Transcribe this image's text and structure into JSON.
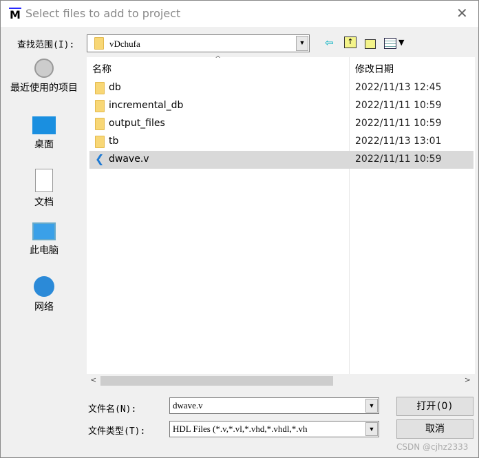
{
  "window": {
    "title": "Select files to add to project",
    "logo": "M"
  },
  "lookin": {
    "label": "查找范围(I):",
    "value": "vDchufa"
  },
  "toolbar": {
    "back": "back-icon",
    "up": "up-folder-icon",
    "new": "new-folder-icon",
    "view": "view-menu-icon"
  },
  "places": [
    {
      "label": "最近使用的项目"
    },
    {
      "label": "桌面"
    },
    {
      "label": "文档"
    },
    {
      "label": "此电脑"
    },
    {
      "label": "网络"
    }
  ],
  "columns": {
    "name": "名称",
    "date": "修改日期"
  },
  "files": [
    {
      "name": "db",
      "date": "2022/11/13 12:45",
      "type": "folder"
    },
    {
      "name": "incremental_db",
      "date": "2022/11/11 10:59",
      "type": "folder"
    },
    {
      "name": "output_files",
      "date": "2022/11/11 10:59",
      "type": "folder"
    },
    {
      "name": "tb",
      "date": "2022/11/13 13:01",
      "type": "folder"
    },
    {
      "name": "dwave.v",
      "date": "2022/11/11 10:59",
      "type": "file",
      "selected": true
    }
  ],
  "filename": {
    "label": "文件名(N):",
    "value": "dwave.v"
  },
  "filetype": {
    "label": "文件类型(T):",
    "value": "HDL Files (*.v,*.vl,*.vhd,*.vhdl,*.vh"
  },
  "buttons": {
    "open": "打开(O)",
    "cancel": "取消"
  },
  "watermark": "CSDN @cjhz2333"
}
